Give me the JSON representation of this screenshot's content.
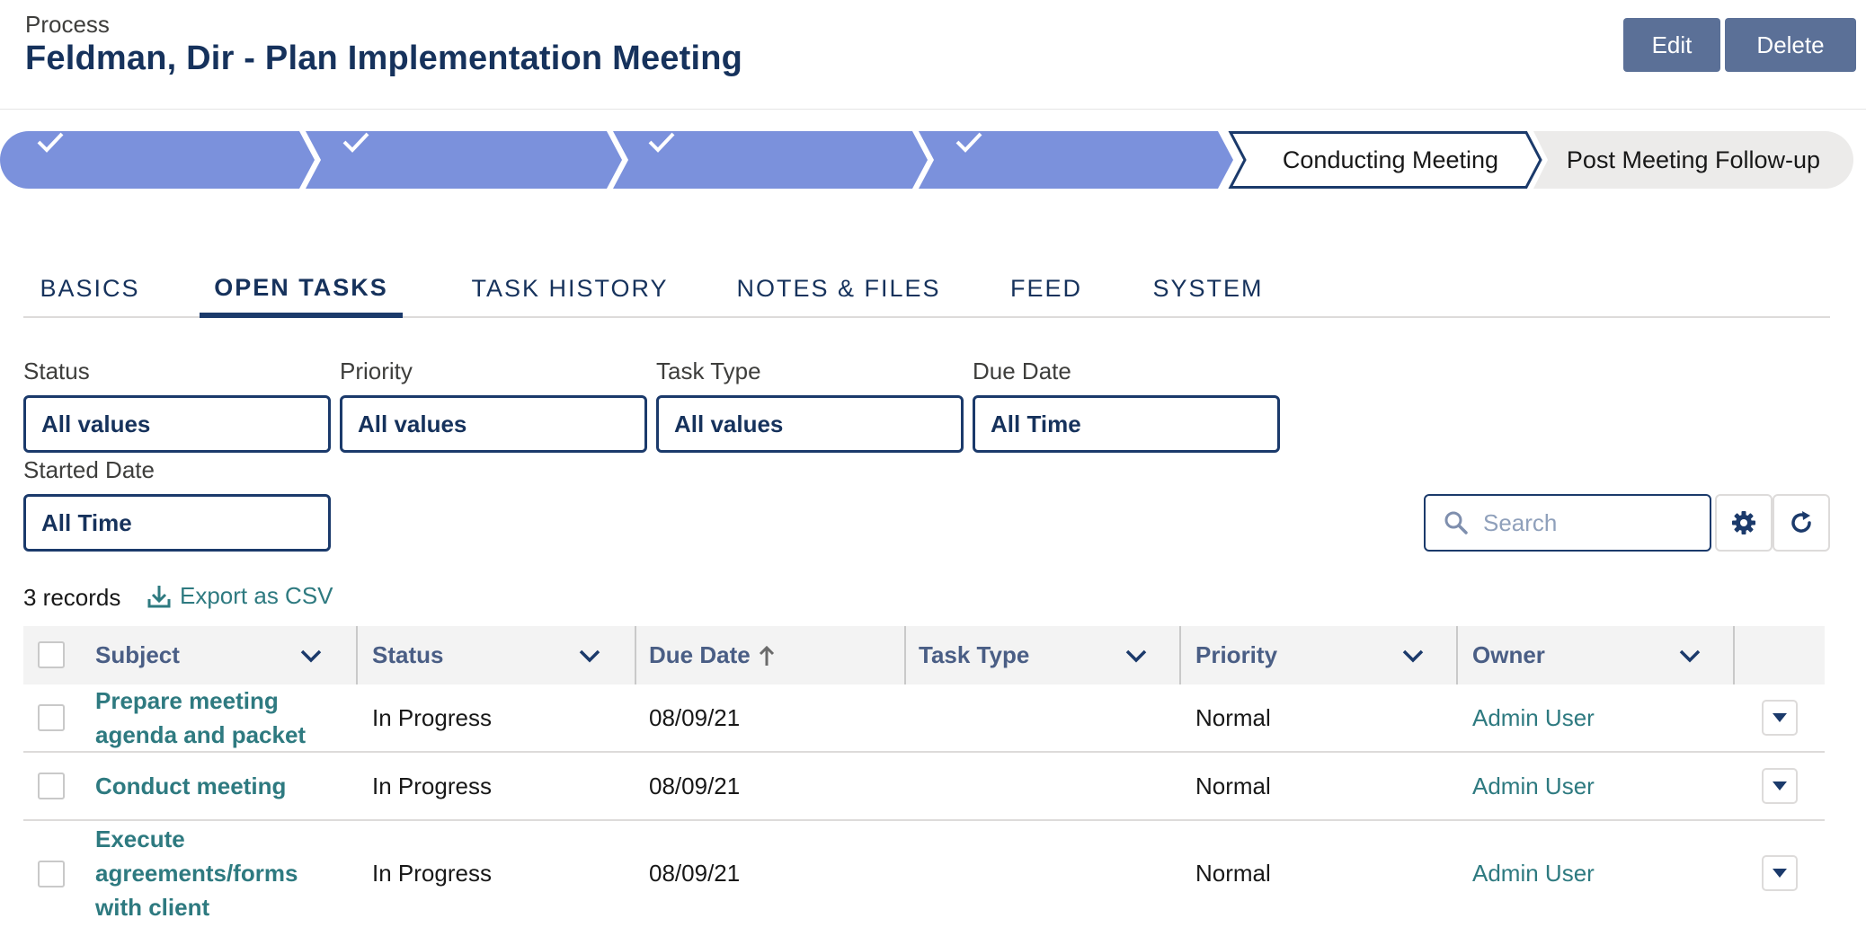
{
  "header": {
    "object_label": "Process",
    "record_title": "Feldman, Dir - Plan Implementation Meeting",
    "edit_label": "Edit",
    "delete_label": "Delete"
  },
  "path": {
    "completed_steps": 4,
    "current_step": "Conducting Meeting",
    "next_step": "Post Meeting Follow-up",
    "completed_color": "#7b91dc",
    "upcoming_color": "#ecebea"
  },
  "tabs": [
    "BASICS",
    "OPEN TASKS",
    "TASK HISTORY",
    "NOTES & FILES",
    "FEED",
    "SYSTEM"
  ],
  "active_tab": "OPEN TASKS",
  "filters": [
    {
      "label": "Status",
      "value": "All values"
    },
    {
      "label": "Priority",
      "value": "All values"
    },
    {
      "label": "Task Type",
      "value": "All values"
    },
    {
      "label": "Due Date",
      "value": "All Time"
    },
    {
      "label": "Started Date",
      "value": "All Time"
    }
  ],
  "search": {
    "placeholder": "Search"
  },
  "toolbar": {
    "record_count": "3 records",
    "export_label": "Export as CSV",
    "settings_icon": "gear-icon",
    "refresh_icon": "refresh-icon"
  },
  "table": {
    "columns": [
      "Subject",
      "Status",
      "Due Date",
      "Task Type",
      "Priority",
      "Owner"
    ],
    "sorted_column": "Due Date",
    "sort_direction": "ascending",
    "rows": [
      {
        "subject": "Prepare meeting agenda and packet",
        "status": "In Progress",
        "due_date": "08/09/21",
        "task_type": "",
        "priority": "Normal",
        "owner": "Admin User"
      },
      {
        "subject": "Conduct meeting",
        "status": "In Progress",
        "due_date": "08/09/21",
        "task_type": "",
        "priority": "Normal",
        "owner": "Admin User"
      },
      {
        "subject": "Execute agreements/forms with client",
        "status": "In Progress",
        "due_date": "08/09/21",
        "task_type": "",
        "priority": "Normal",
        "owner": "Admin User"
      }
    ]
  },
  "colors": {
    "title": "#16325c",
    "link": "#2e7a80",
    "button": "#5b7097"
  }
}
